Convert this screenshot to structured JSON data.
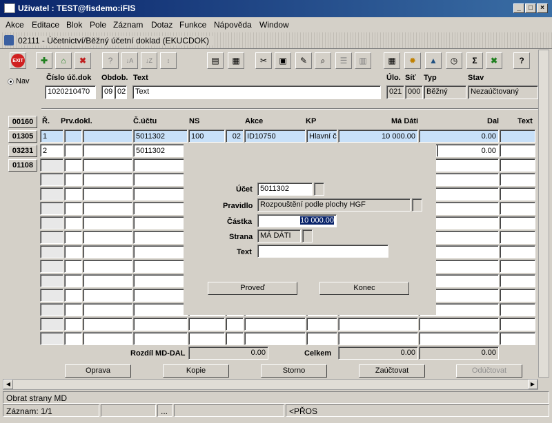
{
  "window": {
    "title": "Uživatel : TEST@fisdemo:iFIS",
    "minimize": "_",
    "maximize": "□",
    "close": "×"
  },
  "menu": [
    "Akce",
    "Editace",
    "Blok",
    "Pole",
    "Záznam",
    "Dotaz",
    "Funkce",
    "Nápověda",
    "Window"
  ],
  "subwindow": {
    "title": "02111 - Účetnictví/Běžný účetní doklad (EKUCDOK)"
  },
  "toolbar": {
    "exit": "EXIT",
    "sigma": "Σ",
    "help": "?"
  },
  "nav_label": "Nav",
  "header": {
    "labels": {
      "doc_no": "Číslo úč.dok",
      "period": "Obdob.",
      "text": "Text",
      "ulo": "Úlo.",
      "sit": "Síť",
      "type": "Typ",
      "state": "Stav"
    },
    "values": {
      "doc_no": "1020210470",
      "period_a": "09",
      "period_b": "02",
      "text": "Text",
      "ulo": "021",
      "sit": "000",
      "type": "Běžný",
      "state": "Nezaúčtovaný"
    }
  },
  "side_buttons": [
    "00160",
    "01305",
    "03231",
    "01108"
  ],
  "grid": {
    "columns": {
      "r": "Ř.",
      "prv": "Prv.dokl.",
      "ucet": "Č.účtu",
      "ns": "NS",
      "akce": "Akce",
      "kp": "KP",
      "md": "Má Dáti",
      "dal": "Dal",
      "text": "Text"
    },
    "row1": {
      "r": "1",
      "ucet": "5011302",
      "ns": "100",
      "akce_a": "02",
      "akce_b": "ID10750",
      "kp": "Hlavní či",
      "md": "10 000.00",
      "dal": "0.00"
    },
    "row2": {
      "r": "2",
      "ucet": "5011302",
      "dal": "0.00"
    }
  },
  "dialog": {
    "labels": {
      "ucet": "Účet",
      "pravidlo": "Pravidlo",
      "castka": "Částka",
      "strana": "Strana",
      "text": "Text"
    },
    "values": {
      "ucet": "5011302",
      "pravidlo": "Rozpouštění podle plochy HGF",
      "castka": "10 000.00",
      "strana": "MÁ DÁTI",
      "text": ""
    },
    "buttons": {
      "proved": "Proveď",
      "konec": "Konec"
    }
  },
  "totals": {
    "rozdil_label": "Rozdíl MD-DAL",
    "rozdil_value": "0.00",
    "celkem_label": "Celkem",
    "celkem_md": "0.00",
    "celkem_dal": "0.00"
  },
  "actions": {
    "oprava": "Oprava",
    "kopie": "Kopie",
    "storno": "Storno",
    "zauctovat": "Zaúčtovat",
    "oductovat": "Odúčtovat"
  },
  "statusbar": {
    "message": "Obrat strany MD",
    "record": "Záznam: 1/1",
    "ellipsis": "...",
    "mode": "<PŘOS"
  }
}
